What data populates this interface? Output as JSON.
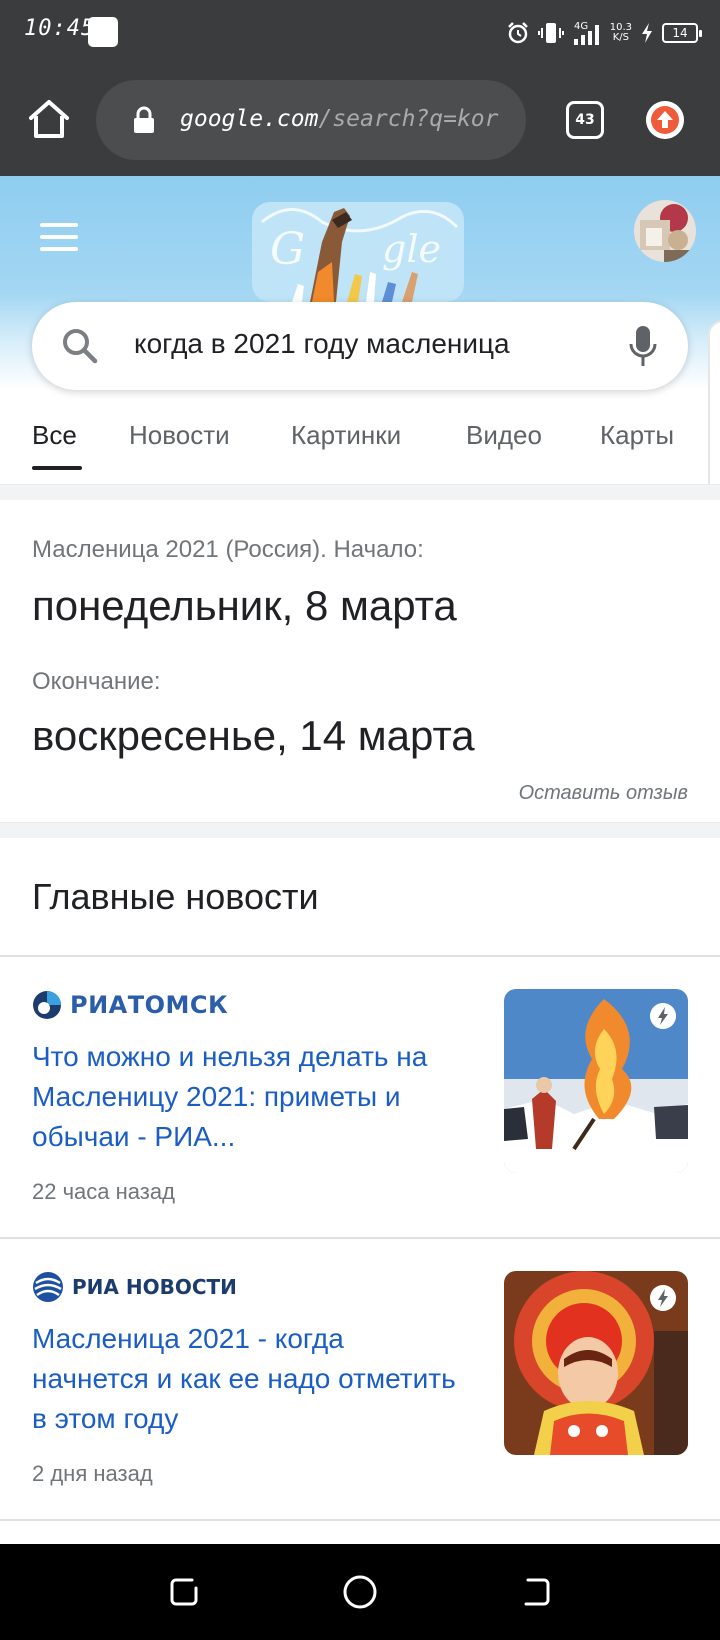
{
  "status_bar": {
    "time": "10:45",
    "network_type": "4G",
    "net_speed_value": "10.3",
    "net_speed_unit": "K/S",
    "battery": "14"
  },
  "browser": {
    "url_host": "google.com",
    "url_path": "/search?q=kor",
    "tab_count": "43"
  },
  "search": {
    "query": "когда в 2021 году масленица"
  },
  "tabs": [
    {
      "label": "Все",
      "active": true
    },
    {
      "label": "Новости",
      "active": false
    },
    {
      "label": "Картинки",
      "active": false
    },
    {
      "label": "Видео",
      "active": false
    },
    {
      "label": "Карты",
      "active": false
    }
  ],
  "answer": {
    "start_label": "Масленица 2021 (Россия). Начало:",
    "start_value": "понедельник, 8 марта",
    "end_label": "Окончание:",
    "end_value": "воскресенье, 14 марта",
    "feedback": "Оставить отзыв"
  },
  "news": {
    "title": "Главные новости",
    "items": [
      {
        "source": "РИАТОМСК",
        "headline": "Что можно и нельзя делать на Масленицу 2021: приметы и обычаи - РИА...",
        "time": "22 часа назад"
      },
      {
        "source": "РИА НОВОСТИ",
        "headline": "Масленица 2021 - когда начнется и как ее надо отметить в этом году",
        "time": "2 дня назад"
      }
    ]
  },
  "colors": {
    "link": "#1a5dc4",
    "chrome_bg": "#3b3c3e",
    "header_sky": "#8fcdf0"
  }
}
